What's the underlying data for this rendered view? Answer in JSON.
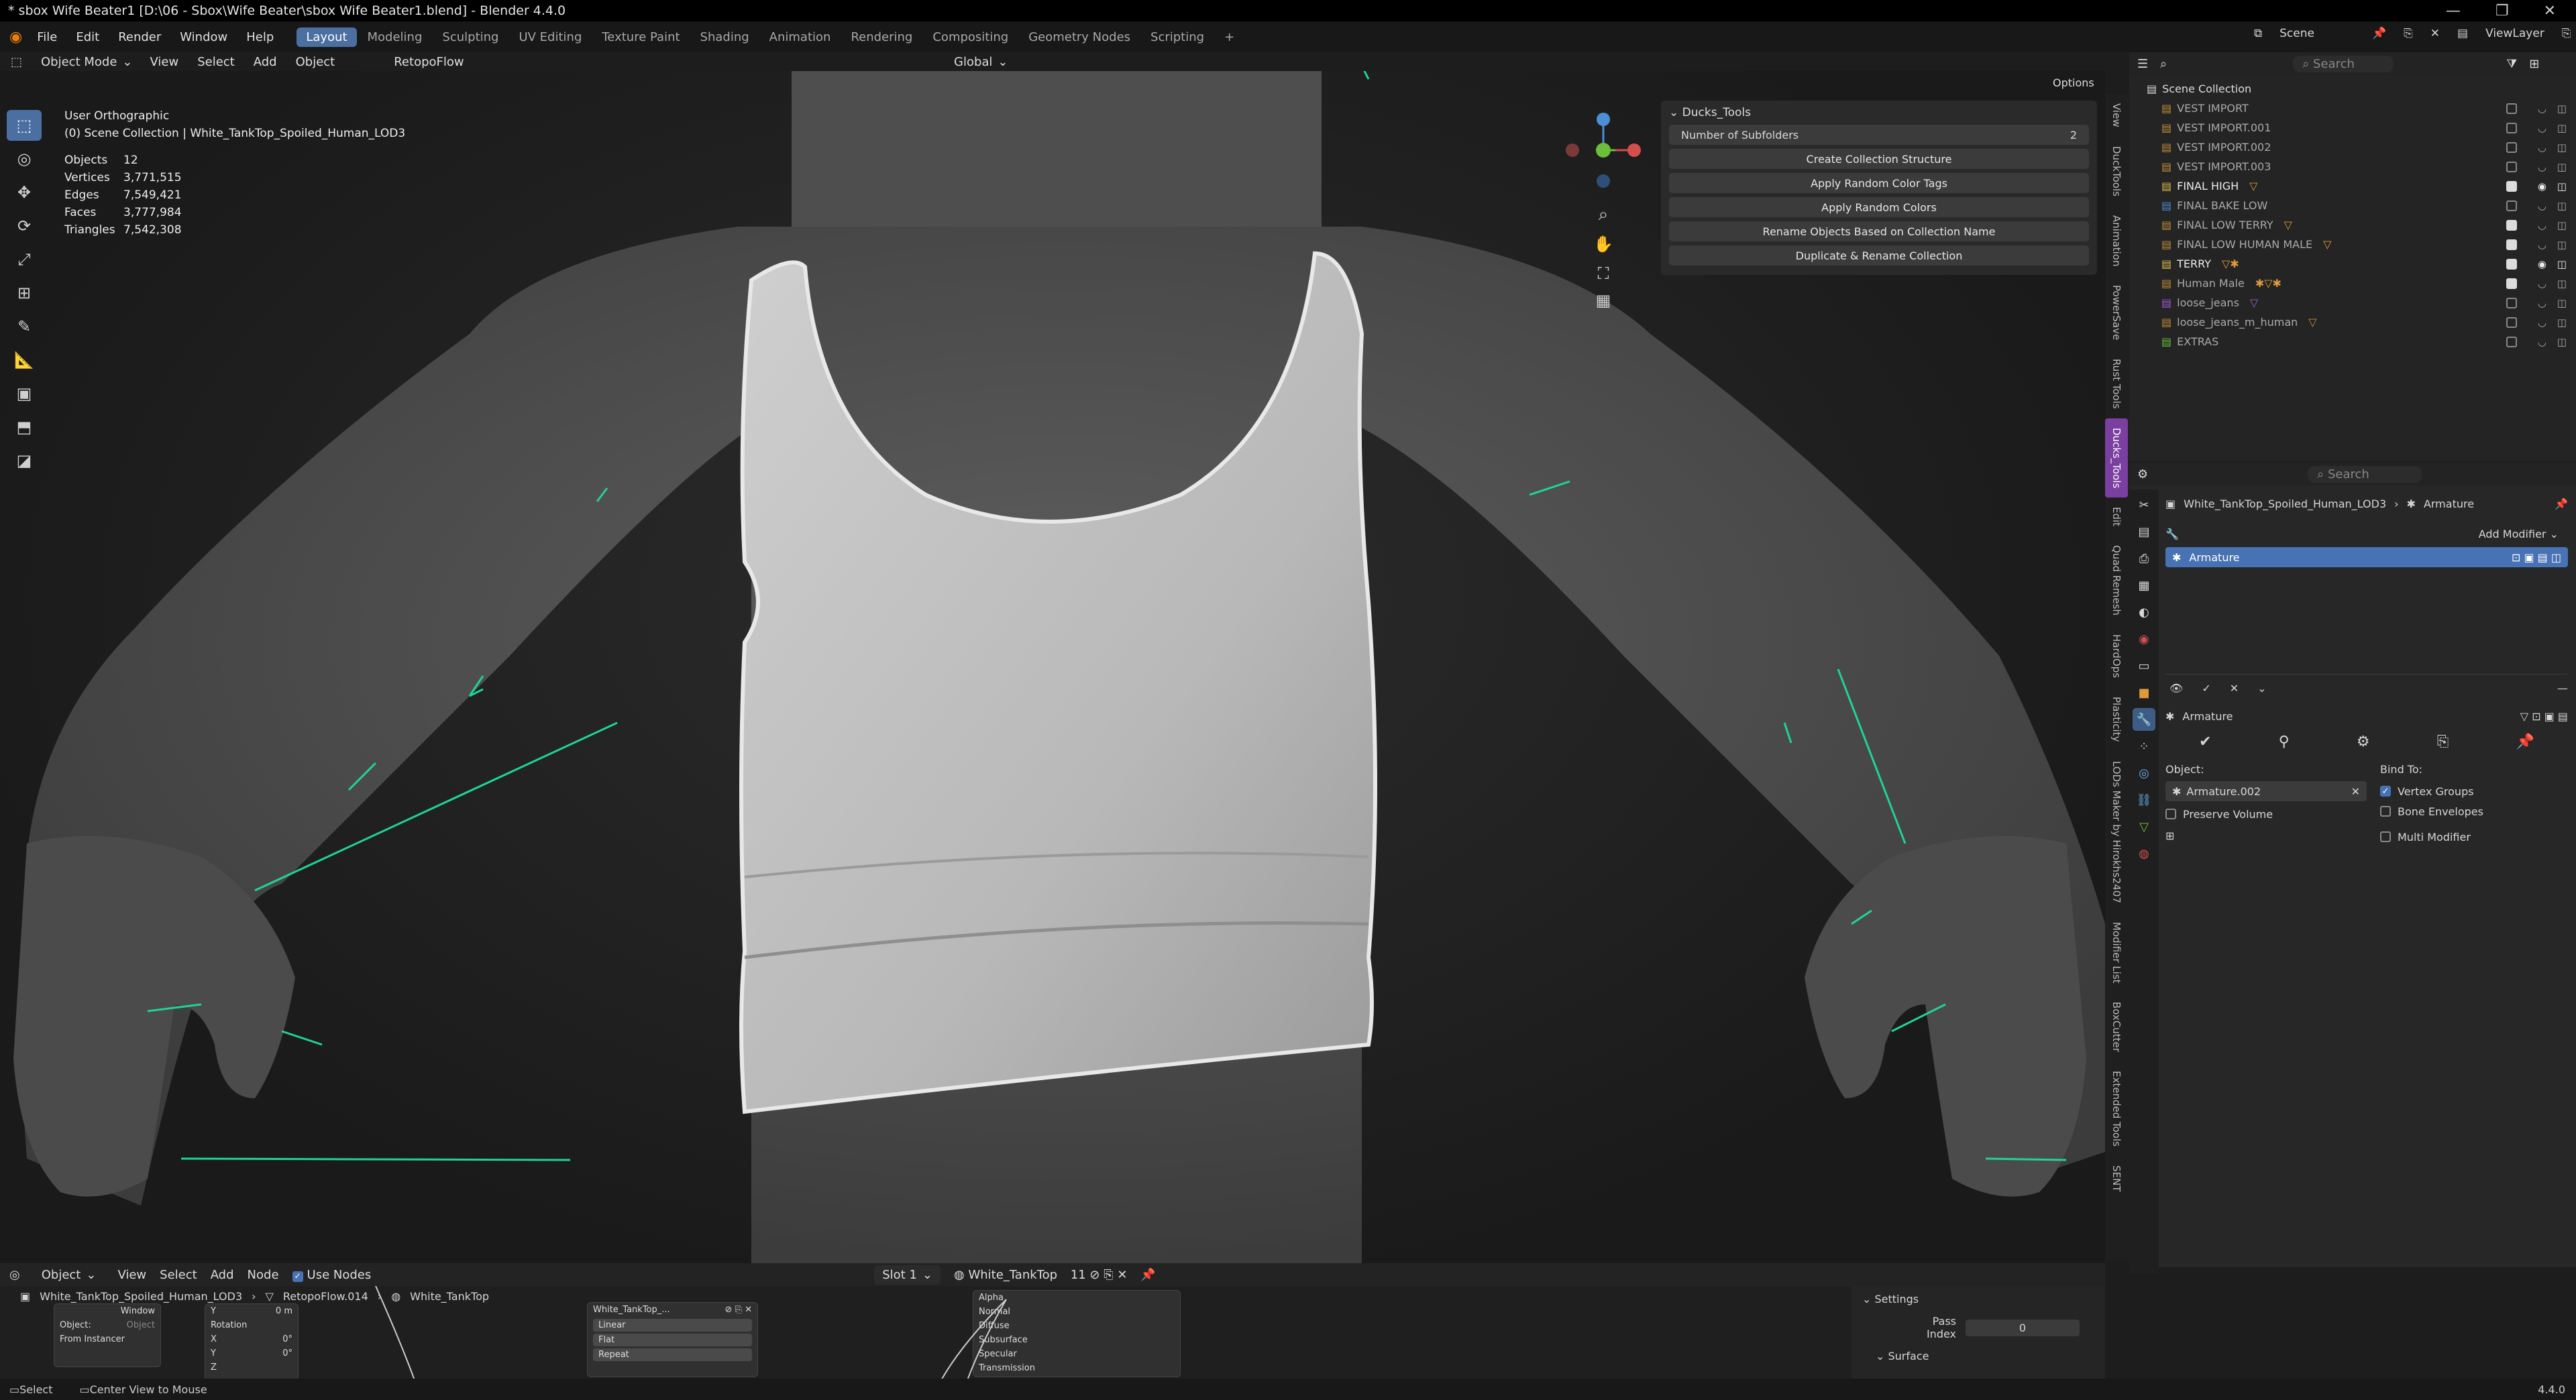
{
  "window": {
    "title": "* sbox Wife Beater1 [D:\\06 - Sbox\\Wife Beater\\sbox Wife Beater1.blend] - Blender 4.4.0"
  },
  "menu": {
    "items": [
      "File",
      "Edit",
      "Render",
      "Window",
      "Help"
    ]
  },
  "workspaces": [
    "Layout",
    "Modeling",
    "Sculpting",
    "UV Editing",
    "Texture Paint",
    "Shading",
    "Animation",
    "Rendering",
    "Compositing",
    "Geometry Nodes",
    "Scripting"
  ],
  "top_right": {
    "scene": "Scene",
    "view_layer": "ViewLayer"
  },
  "viewport_header": {
    "mode": "Object Mode",
    "view": "View",
    "select": "Select",
    "add": "Add",
    "object": "Object",
    "addon": "RetopoFlow",
    "orientation": "Global",
    "options": "Options"
  },
  "viewport_info": {
    "view_name": "User Orthographic",
    "collection_line": "(0) Scene Collection | White_TankTop_Spoiled_Human_LOD3"
  },
  "stats": [
    {
      "label": "Objects",
      "value": "12"
    },
    {
      "label": "Vertices",
      "value": "3,771,515"
    },
    {
      "label": "Edges",
      "value": "7,549,421"
    },
    {
      "label": "Faces",
      "value": "3,777,984"
    },
    {
      "label": "Triangles",
      "value": "7,542,308"
    }
  ],
  "ducks_tools": {
    "title": "Ducks_Tools",
    "subfolders_label": "Number of Subfolders",
    "subfolders_value": "2",
    "actions": [
      "Create Collection Structure",
      "Apply Random Color Tags",
      "Apply Random Colors",
      "Rename Objects Based on Collection Name",
      "Duplicate & Rename Collection"
    ]
  },
  "side_tabs": [
    "View",
    "DuckTools",
    "Animation",
    "PowerSave",
    "Rust Tools",
    "Ducks_Tools",
    "Edit",
    "Quad Remesh",
    "HardOps",
    "Plasticity",
    "LODs Maker by Hirokhs2407",
    "Modifier List",
    "BoxCutter",
    "Extended Tools",
    "SENT"
  ],
  "outliner": {
    "search_placeholder": "Search",
    "root": "Scene Collection",
    "rows": [
      {
        "name": "VEST IMPORT",
        "checked": false,
        "visible": false
      },
      {
        "name": "VEST IMPORT.001",
        "checked": false,
        "visible": false
      },
      {
        "name": "VEST IMPORT.002",
        "checked": false,
        "visible": false
      },
      {
        "name": "VEST IMPORT.003",
        "checked": false,
        "visible": false
      },
      {
        "name": "FINAL HIGH",
        "checked": true,
        "visible": true
      },
      {
        "name": "FINAL BAKE LOW",
        "checked": false,
        "visible": false
      },
      {
        "name": "FINAL LOW TERRY",
        "checked": true,
        "visible": false
      },
      {
        "name": "FINAL LOW HUMAN MALE",
        "checked": true,
        "visible": false
      },
      {
        "name": "TERRY",
        "checked": true,
        "visible": true
      },
      {
        "name": "Human Male",
        "checked": true,
        "visible": false
      },
      {
        "name": "loose_jeans",
        "checked": false,
        "visible": false
      },
      {
        "name": "loose_jeans_m_human",
        "checked": false,
        "visible": false
      },
      {
        "name": "EXTRAS",
        "checked": false,
        "visible": false
      }
    ]
  },
  "properties": {
    "search_placeholder": "Search",
    "object_name": "White_TankTop_Spoiled_Human_LOD3",
    "modifier_crumb": "Armature",
    "add_modifier": "Add Modifier",
    "modifier_list_item": "Armature",
    "panel_name": "Armature",
    "object_label": "Object:",
    "object_value": "Armature.002",
    "bind_to_label": "Bind To:",
    "vertex_groups": "Vertex Groups",
    "bone_envelopes": "Bone Envelopes",
    "preserve_volume": "Preserve Volume",
    "multi_modifier": "Multi Modifier"
  },
  "shader_editor": {
    "object": "Object",
    "view": "View",
    "select": "Select",
    "add": "Add",
    "node": "Node",
    "use_nodes": "Use Nodes",
    "slot": "Slot 1",
    "material": "White_TankTop",
    "users": "11",
    "breadcrumb_obj": "White_TankTop_Spoiled_Human_LOD3",
    "breadcrumb_mod": "RetopoFlow.014",
    "breadcrumb_mat": "White_TankTop"
  },
  "nodes": {
    "window": "Window",
    "object_field": "Object:",
    "object_hint": "Object",
    "from_instancer": "From Instancer",
    "rotation": "Rotation",
    "x": "X",
    "y": "Y",
    "z": "Z",
    "m_unit": "0 m",
    "deg": "0°",
    "texture_name": "White_TankTop_...",
    "linear": "Linear",
    "flat": "Flat",
    "repeat": "Repeat",
    "bsdf_rows": [
      "Alpha",
      "Normal",
      "Diffuse",
      "Subsurface",
      "Specular",
      "Transmission"
    ]
  },
  "settings_panel": {
    "settings": "Settings",
    "pass_index_label": "Pass Index",
    "pass_index_value": "0",
    "surface": "Surface"
  },
  "status": {
    "select": "Select",
    "center_view": "Center View to Mouse",
    "version": "4.4.0"
  }
}
